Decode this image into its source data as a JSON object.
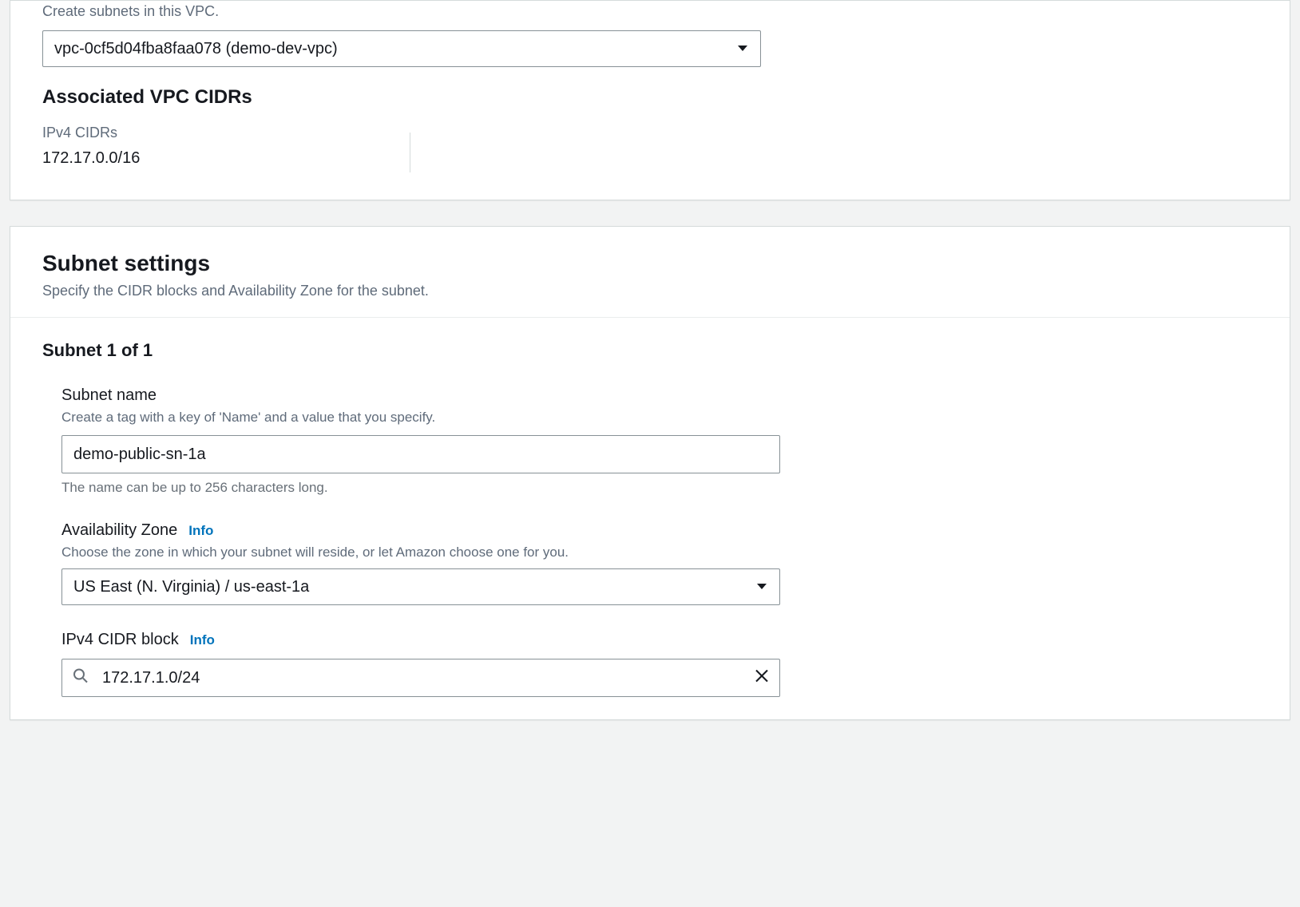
{
  "vpc": {
    "description": "Create subnets in this VPC.",
    "selected": "vpc-0cf5d04fba8faa078 (demo-dev-vpc)",
    "assoc_title": "Associated VPC CIDRs",
    "ipv4_label": "IPv4 CIDRs",
    "ipv4_value": "172.17.0.0/16"
  },
  "subnet_section": {
    "title": "Subnet settings",
    "description": "Specify the CIDR blocks and Availability Zone for the subnet."
  },
  "subnet": {
    "counter": "Subnet 1 of 1",
    "name_label": "Subnet name",
    "name_desc": "Create a tag with a key of 'Name' and a value that you specify.",
    "name_value": "demo-public-sn-1a",
    "name_help": "The name can be up to 256 characters long.",
    "az_label": "Availability Zone",
    "az_info": "Info",
    "az_desc": "Choose the zone in which your subnet will reside, or let Amazon choose one for you.",
    "az_selected": "US East (N. Virginia) / us-east-1a",
    "cidr_label": "IPv4 CIDR block",
    "cidr_info": "Info",
    "cidr_value": "172.17.1.0/24"
  }
}
